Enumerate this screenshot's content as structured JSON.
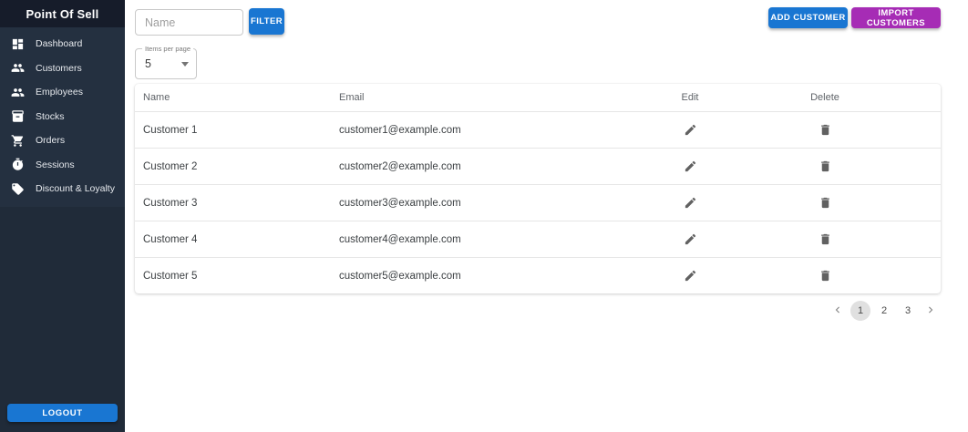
{
  "app": {
    "title": "Point Of Sell"
  },
  "sidebar": {
    "items": [
      {
        "label": "Dashboard",
        "icon": "dashboard-icon"
      },
      {
        "label": "Customers",
        "icon": "people-icon"
      },
      {
        "label": "Employees",
        "icon": "people-icon"
      },
      {
        "label": "Stocks",
        "icon": "inventory-icon"
      },
      {
        "label": "Orders",
        "icon": "cart-icon"
      },
      {
        "label": "Sessions",
        "icon": "timer-icon"
      },
      {
        "label": "Discount & Loyalty",
        "icon": "tag-icon"
      }
    ],
    "logout_label": "LOGOUT"
  },
  "toolbar": {
    "name_placeholder": "Name",
    "filter_label": "FILTER",
    "add_customer_label": "ADD CUSTOMER",
    "import_customers_label": "IMPORT CUSTOMERS"
  },
  "items_per_page": {
    "label": "Items per page",
    "value": "5"
  },
  "table": {
    "columns": [
      "Name",
      "Email",
      "Edit",
      "Delete"
    ],
    "rows": [
      {
        "name": "Customer 1",
        "email": "customer1@example.com"
      },
      {
        "name": "Customer 2",
        "email": "customer2@example.com"
      },
      {
        "name": "Customer 3",
        "email": "customer3@example.com"
      },
      {
        "name": "Customer 4",
        "email": "customer4@example.com"
      },
      {
        "name": "Customer 5",
        "email": "customer5@example.com"
      }
    ]
  },
  "pagination": {
    "pages": [
      "1",
      "2",
      "3"
    ],
    "current_page": "1"
  },
  "colors": {
    "primary_blue": "#1976d2",
    "secondary_purple": "#a62cb5",
    "sidebar_bg": "#202b39",
    "sidebar_header_bg": "#161c2a",
    "sidebar_nav_bg": "#243040",
    "page_current_bg": "#e0e0e0"
  }
}
